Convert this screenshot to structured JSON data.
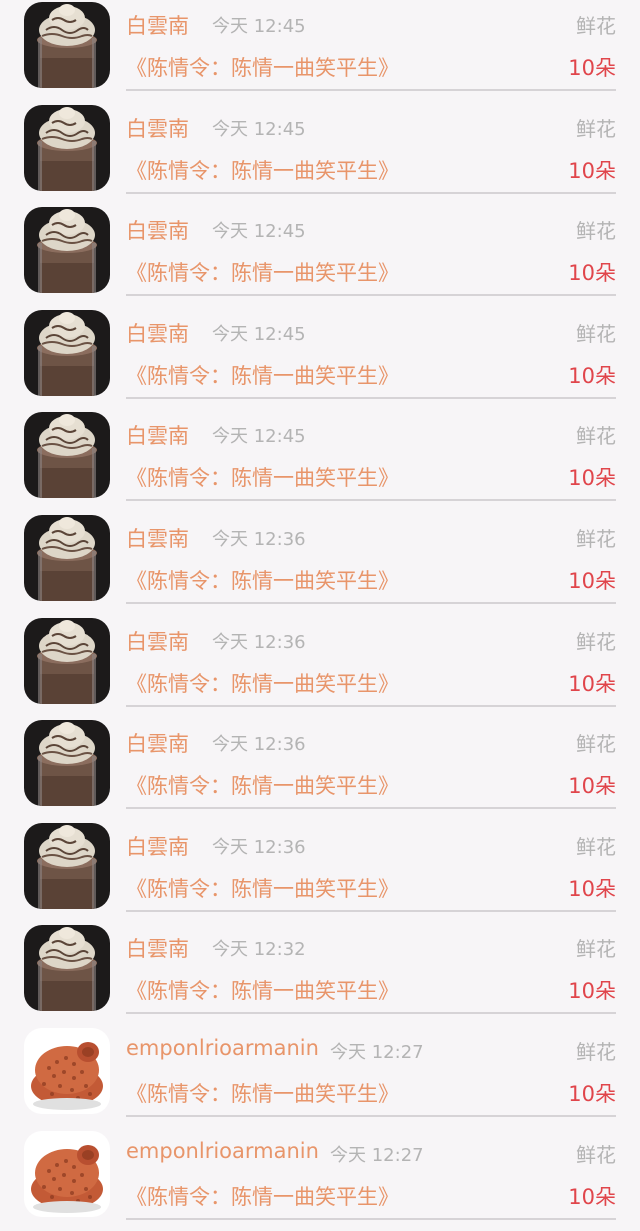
{
  "list": {
    "items": [
      {
        "name": "白雲南",
        "time": "今天 12:45",
        "gift": "鲜花",
        "title": "《陈情令：陈情一曲笑平生》",
        "count": "10朵",
        "avatar": "frappe"
      },
      {
        "name": "白雲南",
        "time": "今天 12:45",
        "gift": "鲜花",
        "title": "《陈情令：陈情一曲笑平生》",
        "count": "10朵",
        "avatar": "frappe"
      },
      {
        "name": "白雲南",
        "time": "今天 12:45",
        "gift": "鲜花",
        "title": "《陈情令：陈情一曲笑平生》",
        "count": "10朵",
        "avatar": "frappe"
      },
      {
        "name": "白雲南",
        "time": "今天 12:45",
        "gift": "鲜花",
        "title": "《陈情令：陈情一曲笑平生》",
        "count": "10朵",
        "avatar": "frappe"
      },
      {
        "name": "白雲南",
        "time": "今天 12:45",
        "gift": "鲜花",
        "title": "《陈情令：陈情一曲笑平生》",
        "count": "10朵",
        "avatar": "frappe"
      },
      {
        "name": "白雲南",
        "time": "今天 12:36",
        "gift": "鲜花",
        "title": "《陈情令：陈情一曲笑平生》",
        "count": "10朵",
        "avatar": "frappe"
      },
      {
        "name": "白雲南",
        "time": "今天 12:36",
        "gift": "鲜花",
        "title": "《陈情令：陈情一曲笑平生》",
        "count": "10朵",
        "avatar": "frappe"
      },
      {
        "name": "白雲南",
        "time": "今天 12:36",
        "gift": "鲜花",
        "title": "《陈情令：陈情一曲笑平生》",
        "count": "10朵",
        "avatar": "frappe"
      },
      {
        "name": "白雲南",
        "time": "今天 12:36",
        "gift": "鲜花",
        "title": "《陈情令：陈情一曲笑平生》",
        "count": "10朵",
        "avatar": "frappe"
      },
      {
        "name": "白雲南",
        "time": "今天 12:32",
        "gift": "鲜花",
        "title": "《陈情令：陈情一曲笑平生》",
        "count": "10朵",
        "avatar": "frappe"
      },
      {
        "name": "emponlrioarmanin",
        "time": "今天 12:27",
        "gift": "鲜花",
        "title": "《陈情令：陈情一曲笑平生》",
        "count": "10朵",
        "avatar": "hat"
      },
      {
        "name": "emponlrioarmanin",
        "time": "今天 12:27",
        "gift": "鲜花",
        "title": "《陈情令：陈情一曲笑平生》",
        "count": "10朵",
        "avatar": "hat"
      }
    ]
  },
  "colors": {
    "name": "#e8956a",
    "title": "#e8956a",
    "count": "#e0454b",
    "meta": "#b4b4b4",
    "divider": "#d6d3d6",
    "background": "#f7f5f7"
  }
}
